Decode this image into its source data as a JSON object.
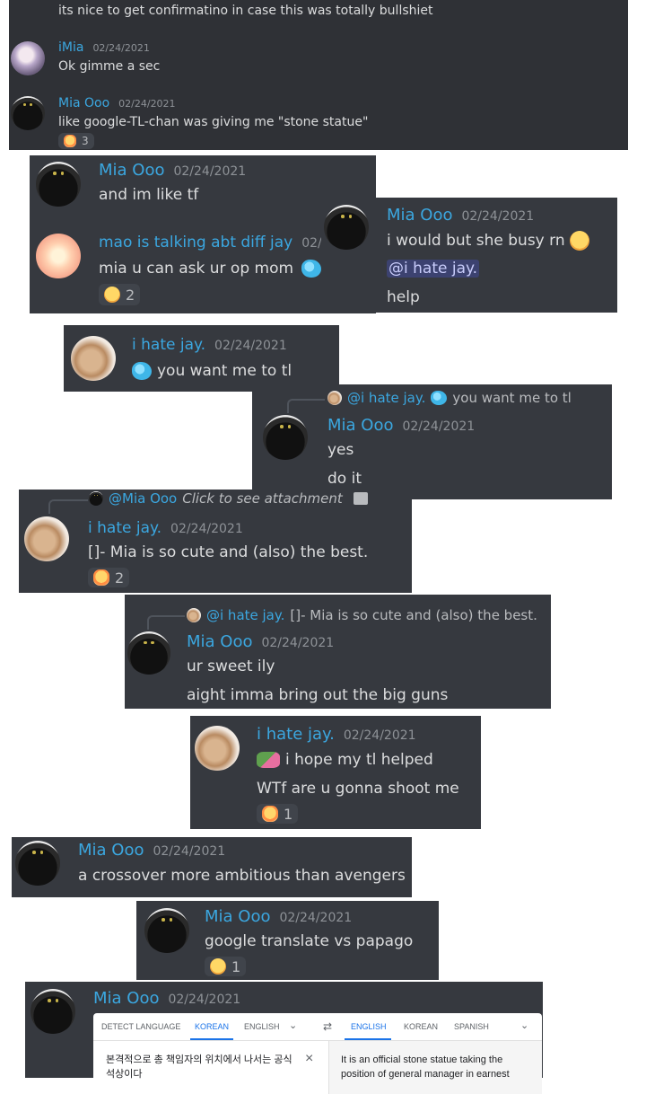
{
  "card1": {
    "top_text": "its nice to get confirmatino in case this was totally bullshiet",
    "m1": {
      "name": "iMia",
      "time": "02/24/2021",
      "text": "Ok gimme a sec"
    },
    "m2": {
      "name": "Mia Ooo",
      "time": "02/24/2021",
      "text": "like google-TL-chan was giving me \"stone statue\"",
      "react_count": "3"
    }
  },
  "card2": {
    "m1": {
      "name": "Mia Ooo",
      "time": "02/24/2021",
      "text": "and im like tf"
    },
    "m2": {
      "name": "mao is talking abt diff jay",
      "time": "02/",
      "text": "mia u can ask ur op mom",
      "react_count": "2"
    }
  },
  "card3": {
    "name": "Mia Ooo",
    "time": "02/24/2021",
    "line1": "i would but she busy rn",
    "mention": "@i hate jay.",
    "line3": "help"
  },
  "card4": {
    "name": "i hate jay.",
    "time": "02/24/2021",
    "text": "you want me to tl"
  },
  "card5": {
    "reply_name": "@i hate jay.",
    "reply_text": "you want me to tl",
    "name": "Mia Ooo",
    "time": "02/24/2021",
    "line1": "yes",
    "line2": "do it"
  },
  "card6": {
    "reply_name": "@Mia Ooo",
    "reply_text": "Click to see attachment",
    "name": "i hate jay.",
    "time": "02/24/2021",
    "text": "[]- Mia is so cute and (also) the best.",
    "react_count": "2"
  },
  "card7": {
    "reply_name": "@i hate jay.",
    "reply_text": "[]- Mia is so cute and (also) the best.",
    "name": "Mia Ooo",
    "time": "02/24/2021",
    "line1": "ur sweet ily",
    "line2": "aight imma bring out the big guns"
  },
  "card8": {
    "name": "i hate jay.",
    "time": "02/24/2021",
    "line1": "i hope my tl helped",
    "line2": "WTf are u gonna shoot me",
    "react_count": "1"
  },
  "card9": {
    "name": "Mia Ooo",
    "time": "02/24/2021",
    "text": "a crossover more ambitious than avengers"
  },
  "card10": {
    "name": "Mia Ooo",
    "time": "02/24/2021",
    "text": "google translate vs papago",
    "react_count": "1"
  },
  "card11": {
    "name": "Mia Ooo",
    "time": "02/24/2021",
    "translate": {
      "src_tabs": [
        "DETECT LANGUAGE",
        "KOREAN",
        "ENGLISH"
      ],
      "swap": "⇄",
      "dst_tabs": [
        "ENGLISH",
        "KOREAN",
        "SPANISH"
      ],
      "source_text": "본격적으로 총 책임자의 위치에서 나서는 공식 석상이다",
      "clear": "×",
      "result_text": "It is an official stone statue taking the position of general manager in earnest"
    }
  },
  "colors": {
    "name": "#3ba7e0",
    "bg": "#36393f",
    "timestamp": "#8e9297"
  }
}
